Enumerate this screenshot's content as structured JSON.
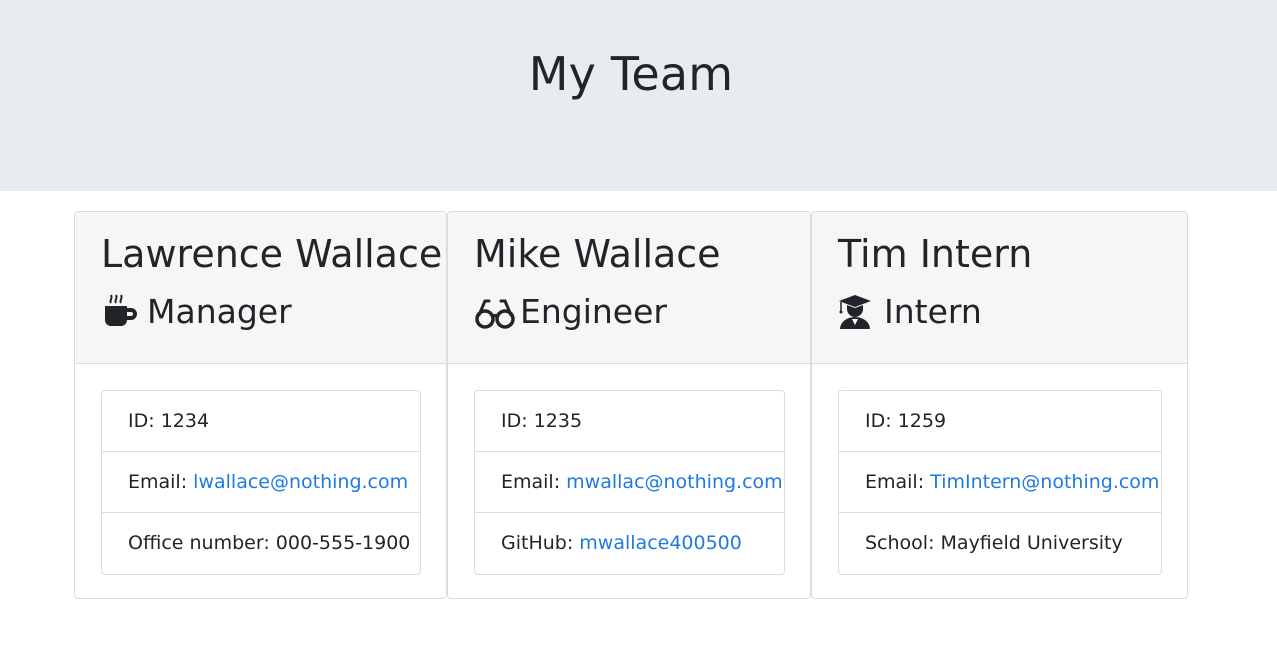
{
  "header": {
    "title": "My Team"
  },
  "employees": [
    {
      "name": "Lawrence Wallace",
      "role": "Manager",
      "icon": "mug-icon",
      "id_label": "ID:",
      "id": "1234",
      "email_label": "Email:",
      "email": "lwallace@nothing.com",
      "extra_label": "Office number:",
      "extra": "000-555-1900"
    },
    {
      "name": "Mike Wallace",
      "role": "Engineer",
      "icon": "glasses-icon",
      "id_label": "ID:",
      "id": "1235",
      "email_label": "Email:",
      "email": "mwallac@nothing.com",
      "extra_label": "GitHub:",
      "extra": "mwallace400500"
    },
    {
      "name": "Tim Intern",
      "role": "Intern",
      "icon": "graduate-icon",
      "id_label": "ID:",
      "id": "1259",
      "email_label": "Email:",
      "email": "TimIntern@nothing.com",
      "extra_label": "School:",
      "extra": "Mayfield University"
    }
  ],
  "colors": {
    "link": "#1f7ae0",
    "header_bg": "#e9ecef",
    "card_header_bg": "#f6f6f6"
  }
}
